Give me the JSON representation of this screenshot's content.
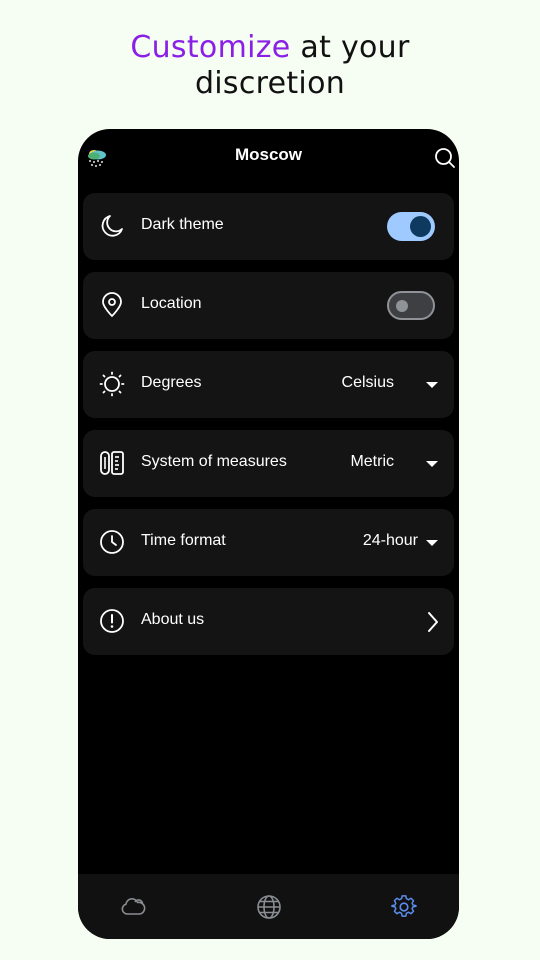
{
  "headline": {
    "accent": "Customize",
    "rest_line1": " at your",
    "line2": "discretion"
  },
  "header": {
    "city": "Moscow",
    "weather_icon": "rain-cloud-icon",
    "search_icon": "search-icon"
  },
  "settings": {
    "dark_theme": {
      "label": "Dark theme",
      "icon": "moon-icon",
      "enabled": true
    },
    "location": {
      "label": "Location",
      "icon": "location-pin-icon",
      "enabled": false
    },
    "degrees": {
      "label": "Degrees",
      "icon": "sun-icon",
      "value": "Celsius"
    },
    "measures": {
      "label": "System of measures",
      "icon": "ruler-icon",
      "value": "Metric"
    },
    "time_format": {
      "label": "Time format",
      "icon": "clock-icon",
      "value": "24-hour"
    },
    "about": {
      "label": "About us",
      "icon": "info-icon"
    }
  },
  "bottom_nav": {
    "items": [
      {
        "icon": "weather-cloud-icon",
        "active": false
      },
      {
        "icon": "globe-icon",
        "active": false
      },
      {
        "icon": "settings-gear-icon",
        "active": true
      }
    ]
  },
  "colors": {
    "accent": "#8a1fe6",
    "toggle_on": "#9ecaff",
    "active_nav": "#5b8def",
    "background": "#f6fdf2"
  }
}
